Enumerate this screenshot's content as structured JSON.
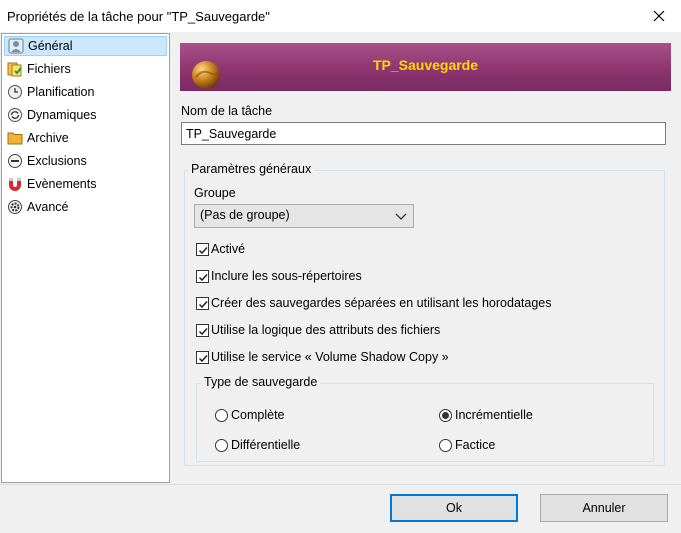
{
  "window": {
    "title": "Propriétés de la tâche pour \"TP_Sauvegarde\"",
    "close_glyph": "✕"
  },
  "sidebar": {
    "items": [
      {
        "label": "Général",
        "icon": "general-icon",
        "selected": true
      },
      {
        "label": "Fichiers",
        "icon": "files-icon",
        "selected": false
      },
      {
        "label": "Planification",
        "icon": "clock-icon",
        "selected": false
      },
      {
        "label": "Dynamiques",
        "icon": "refresh-icon",
        "selected": false
      },
      {
        "label": "Archive",
        "icon": "folder-icon",
        "selected": false
      },
      {
        "label": "Exclusions",
        "icon": "minus-circle-icon",
        "selected": false
      },
      {
        "label": "Evènements",
        "icon": "magnet-icon",
        "selected": false
      },
      {
        "label": "Avancé",
        "icon": "gear-icon",
        "selected": false
      }
    ]
  },
  "banner": {
    "title": "TP_Sauvegarde",
    "title_color": "#ffd800",
    "background": "#8e3570"
  },
  "task_name": {
    "label": "Nom de la tâche",
    "value": "TP_Sauvegarde"
  },
  "general": {
    "caption": "Paramètres généraux",
    "group_label": "Groupe",
    "group_value": "(Pas de groupe)",
    "options": [
      {
        "label": "Activé",
        "checked": true
      },
      {
        "label": "Inclure les sous-répertoires",
        "checked": true
      },
      {
        "label": "Créer des sauvegardes séparées en utilisant les horodatages",
        "checked": true
      },
      {
        "label": "Utilise la logique des attributs des fichiers",
        "checked": true
      },
      {
        "label": "Utilise le service « Volume Shadow Copy »",
        "checked": true
      }
    ]
  },
  "backup_type": {
    "caption": "Type de sauvegarde",
    "options": [
      {
        "label": "Complète",
        "selected": false
      },
      {
        "label": "Incrémentielle",
        "selected": true
      },
      {
        "label": "Différentielle",
        "selected": false
      },
      {
        "label": "Factice",
        "selected": false
      }
    ]
  },
  "buttons": {
    "ok": "Ok",
    "cancel": "Annuler",
    "accent": "#0078d7"
  }
}
